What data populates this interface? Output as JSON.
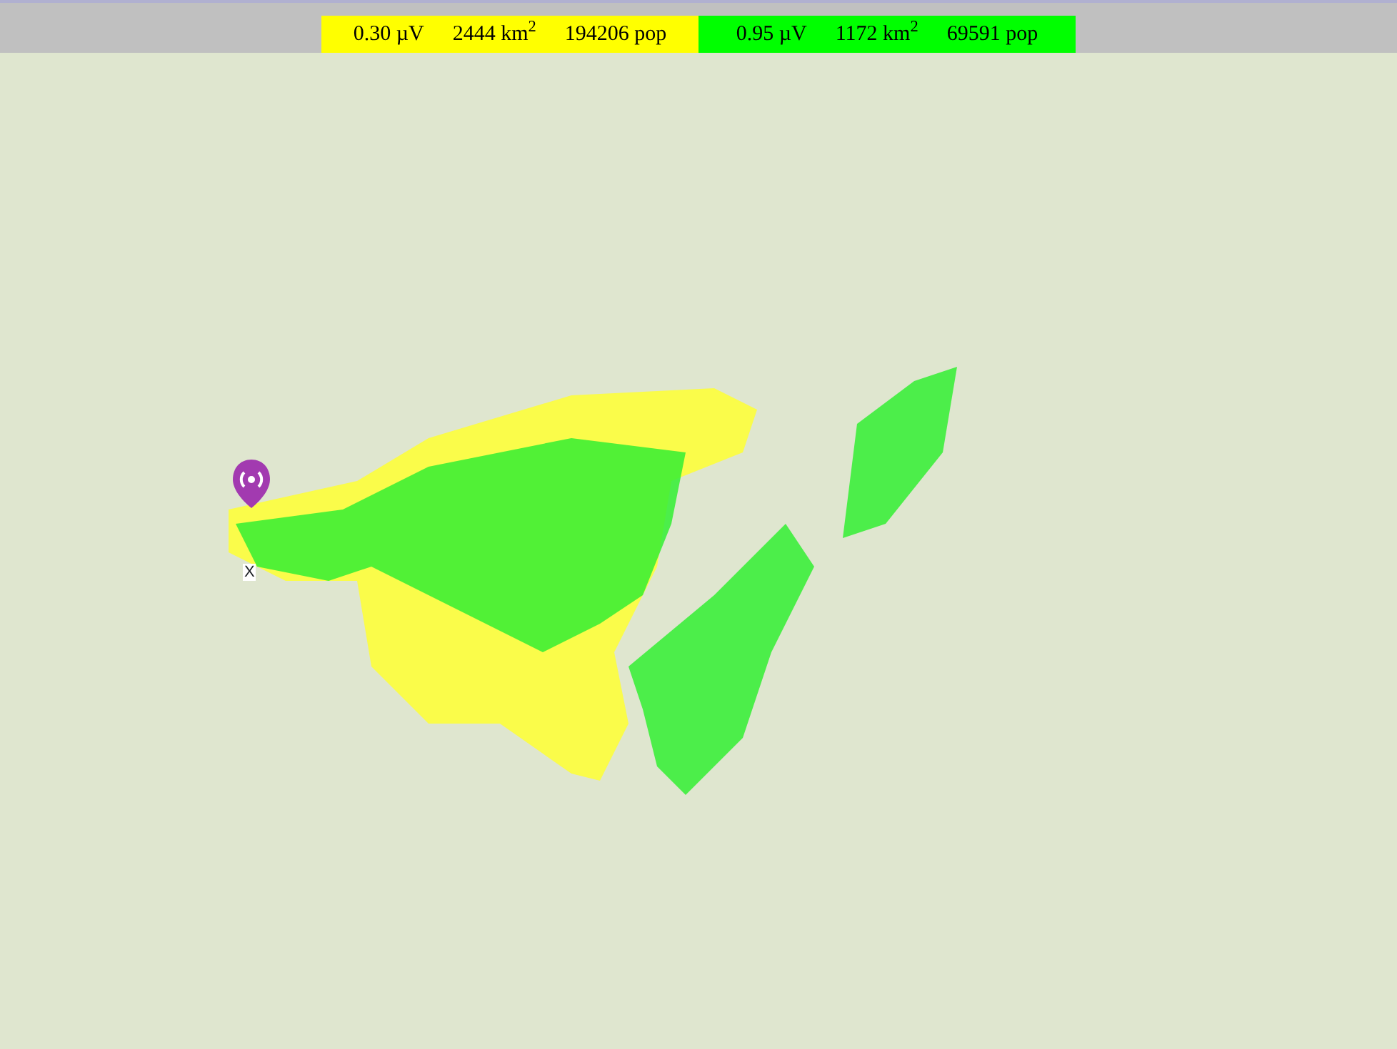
{
  "legend": [
    {
      "color": "#ffff00",
      "signal": "0.30 µV",
      "area": "2444 km$^{2}$",
      "population": "194206 pop"
    },
    {
      "color": "#00ff00",
      "signal": "0.95 µV",
      "area": "1172 km$^{2}$",
      "population": "69591 pop"
    }
  ],
  "map": {
    "marker": {
      "label": "X"
    }
  }
}
